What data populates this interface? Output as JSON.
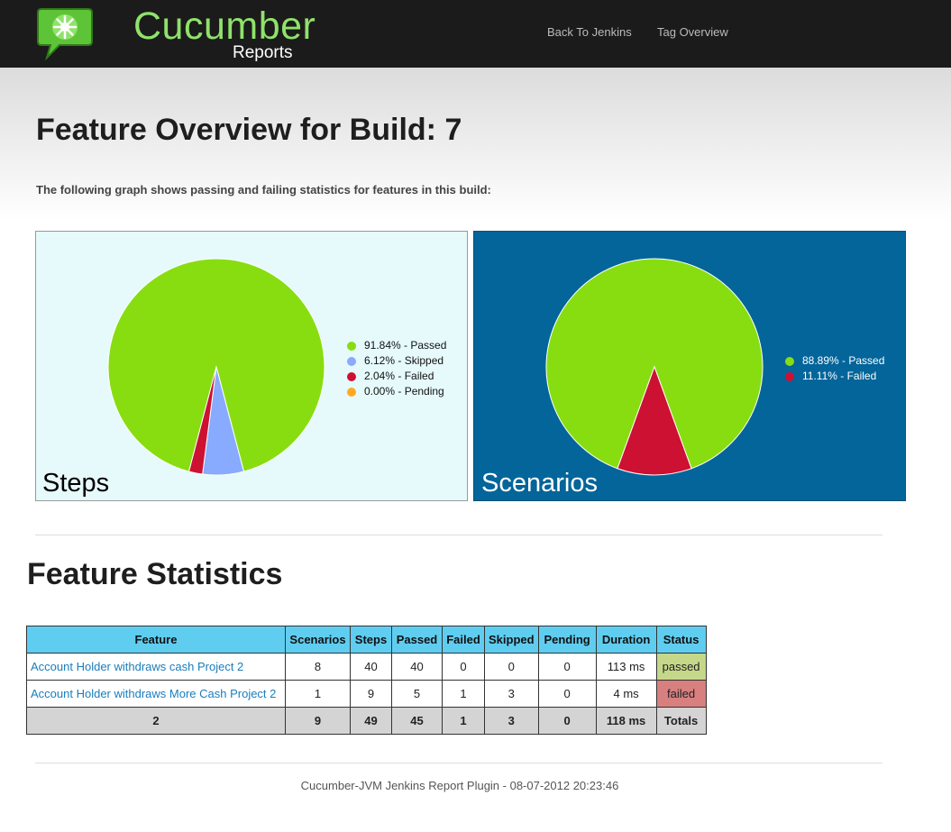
{
  "header": {
    "logo_title": "Cucumber",
    "logo_subtitle": "Reports",
    "nav": [
      "Back To Jenkins",
      "Tag Overview"
    ]
  },
  "page": {
    "title": "Feature Overview for Build: 7",
    "subtitle": "The following graph shows passing and failing statistics for features in this build:"
  },
  "chart_data": [
    {
      "type": "pie",
      "title": "Steps",
      "legend_position": "right",
      "slices": [
        {
          "label": "91.84% - Passed",
          "value": 91.84,
          "color": "#88dd11"
        },
        {
          "label": "6.12% - Skipped",
          "value": 6.12,
          "color": "#88aaff"
        },
        {
          "label": "2.04% - Failed",
          "value": 2.04,
          "color": "#cc1133"
        },
        {
          "label": "0.00% - Pending",
          "value": 0.0,
          "color": "#ffaa22"
        }
      ]
    },
    {
      "type": "pie",
      "title": "Scenarios",
      "legend_position": "right",
      "slices": [
        {
          "label": "88.89% - Passed",
          "value": 88.89,
          "color": "#88dd11"
        },
        {
          "label": "11.11% - Failed",
          "value": 11.11,
          "color": "#cc1133"
        }
      ]
    }
  ],
  "stats": {
    "heading": "Feature Statistics",
    "columns": [
      "Feature",
      "Scenarios",
      "Steps",
      "Passed",
      "Failed",
      "Skipped",
      "Pending",
      "Duration",
      "Status"
    ],
    "rows": [
      [
        "Account Holder withdraws cash Project 2",
        "8",
        "40",
        "40",
        "0",
        "0",
        "0",
        "113 ms",
        "passed"
      ],
      [
        "Account Holder withdraws More Cash Project 2",
        "1",
        "9",
        "5",
        "1",
        "3",
        "0",
        "4 ms",
        "failed"
      ]
    ],
    "totals": [
      "2",
      "9",
      "49",
      "45",
      "1",
      "3",
      "0",
      "118 ms",
      "Totals"
    ]
  },
  "footer": "Cucumber-JVM Jenkins Report Plugin - 08-07-2012 20:23:46",
  "colors": {
    "topbar": "#1b1b1b",
    "logo_green": "#8fe26a",
    "table_header": "#5fcdf0",
    "status_passed": "#c5d88a",
    "status_failed": "#d87f7f",
    "scenarios_panel": "#03659a",
    "steps_panel": "#e6fafc"
  }
}
